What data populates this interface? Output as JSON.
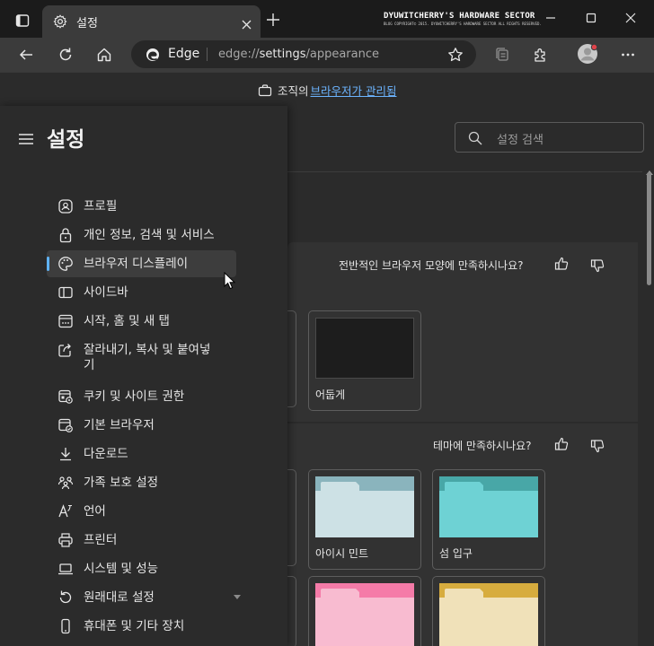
{
  "window": {
    "tab_title": "설정",
    "watermark_title": "DYUWITCHERRY'S HARDWARE SECTOR",
    "watermark_sub": "BLOG COPYRIGHT© 2015. DYUWITCHERRY'S HARDWARE SECTOR ALL RIGHTS RESERVED."
  },
  "toolbar": {
    "browser_label": "Edge",
    "url_prefix": "edge://",
    "url_host": "settings",
    "url_path": "/appearance"
  },
  "managed_bar": {
    "prefix": "조직의",
    "link": "브라우저가 관리됨"
  },
  "settings": {
    "title": "설정",
    "search_placeholder": "설정 검색",
    "nav": [
      {
        "label": "프로필",
        "icon": "profile-icon"
      },
      {
        "label": "개인 정보, 검색 및 서비스",
        "icon": "lock-icon"
      },
      {
        "label": "브라우저 디스플레이",
        "icon": "palette-icon",
        "selected": true
      },
      {
        "label": "사이드바",
        "icon": "sidebar-icon"
      },
      {
        "label": "시작, 홈 및 새 탭",
        "icon": "new-tab-icon"
      },
      {
        "label": "잘라내기, 복사 및 붙여넣",
        "label2": "기",
        "icon": "share-icon"
      },
      {
        "label": "쿠키 및 사이트 권한",
        "icon": "site-permissions-icon"
      },
      {
        "label": "기본 브라우저",
        "icon": "default-browser-icon"
      },
      {
        "label": "다운로드",
        "icon": "download-icon"
      },
      {
        "label": "가족 보호 설정",
        "icon": "family-icon"
      },
      {
        "label": "언어",
        "icon": "language-icon"
      },
      {
        "label": "프린터",
        "icon": "printer-icon"
      },
      {
        "label": "시스템 및 성능",
        "icon": "laptop-icon"
      },
      {
        "label": "원래대로 설정",
        "icon": "reset-icon"
      },
      {
        "label": "휴대폰 및 기타 장치",
        "icon": "phone-icon"
      }
    ]
  },
  "appearance": {
    "overall_feedback": "전반적인 브라우저 모양에 만족하시나요?",
    "theme_feedback": "테마에 만족하시나요?",
    "themes": [
      {
        "label": "어둡게",
        "bar": "#1d1d1d",
        "body": "#1d1d1d"
      },
      {
        "label": "아이시 민트",
        "bar": "#8ab4bd",
        "body": "#cde1e5"
      },
      {
        "label": "섬 입구",
        "bar": "#48a7a7",
        "body": "#6ed2d4"
      },
      {
        "label": "",
        "bar": "#f57ba8",
        "body": "#f8bbd0"
      },
      {
        "label": "",
        "bar": "#d7ac3e",
        "body": "#f0e1b9"
      }
    ]
  },
  "colors": {
    "accent": "#5fb2f5",
    "link": "#6cb4ff"
  }
}
